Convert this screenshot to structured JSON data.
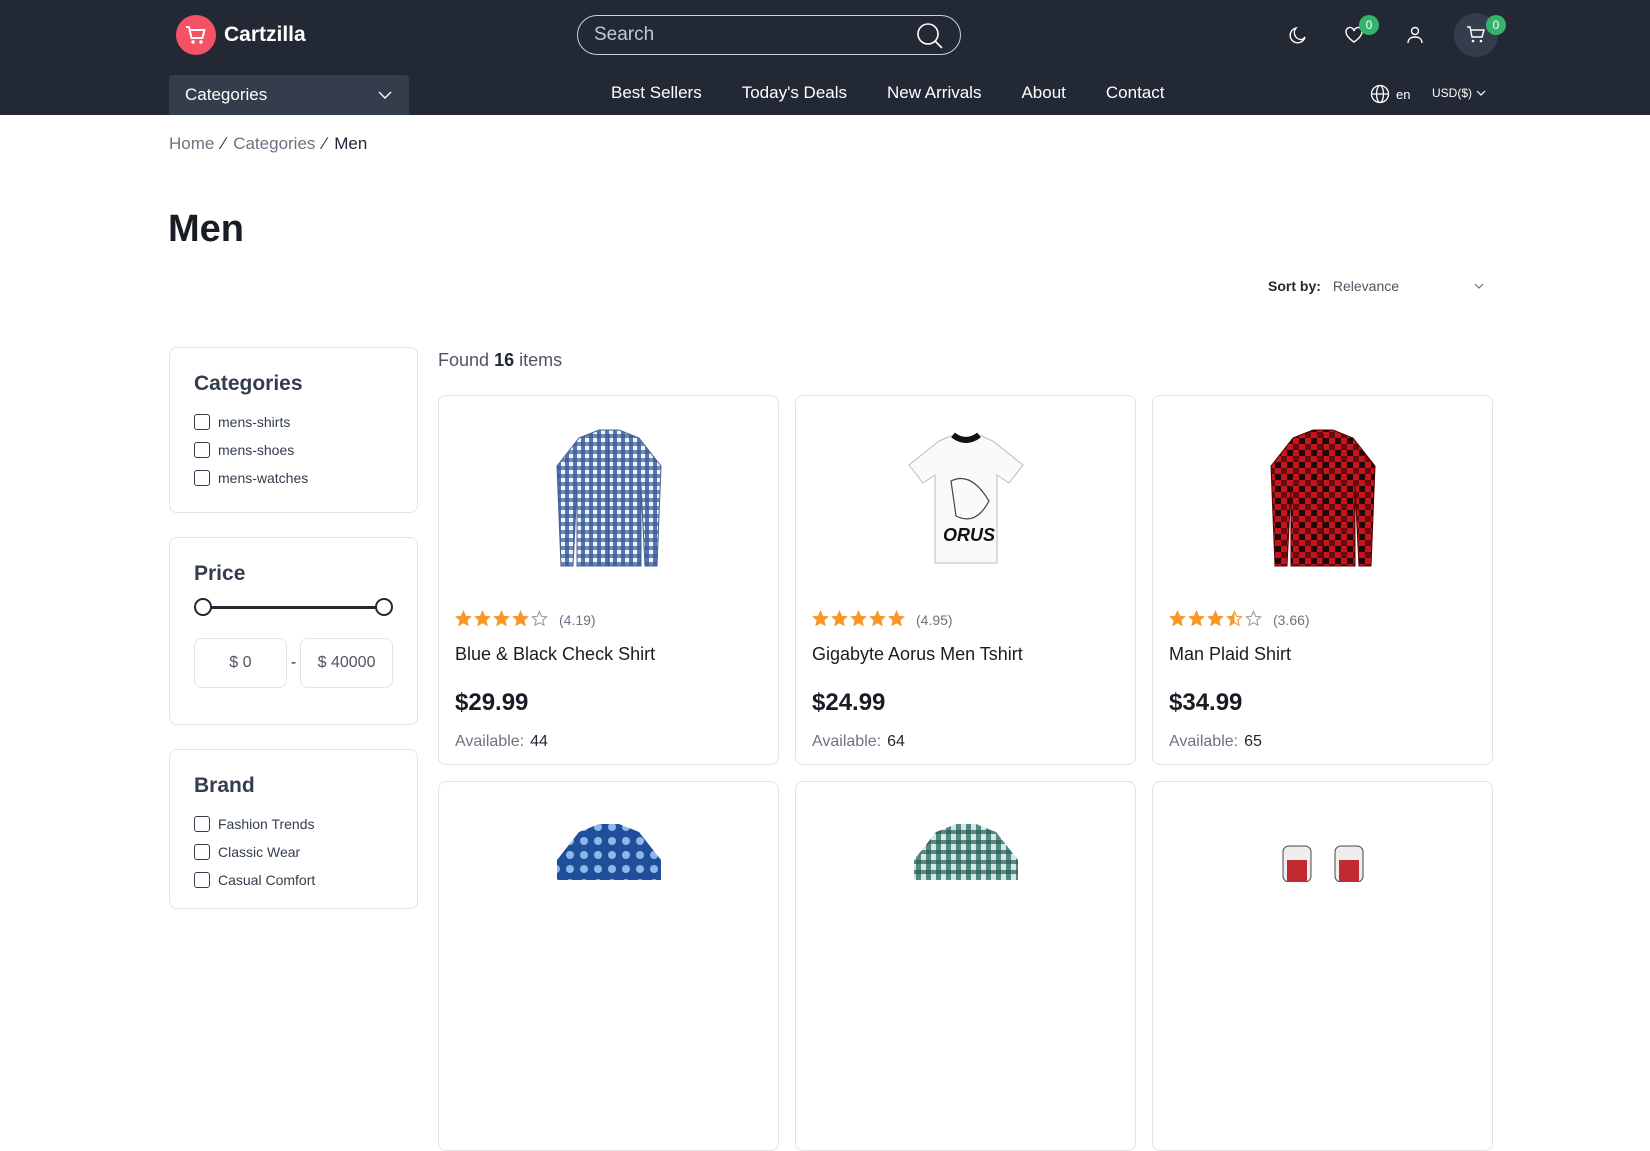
{
  "brand": {
    "name": "Cartzilla",
    "color": "#f55266"
  },
  "search": {
    "placeholder": "Search"
  },
  "header": {
    "wishlist_count": "0",
    "cart_count": "0"
  },
  "categories_dropdown": {
    "label": "Categories"
  },
  "nav": [
    "Best Sellers",
    "Today's Deals",
    "New Arrivals",
    "About",
    "Contact"
  ],
  "language": "en",
  "currency": "USD($)",
  "breadcrumb": {
    "home": "Home",
    "categories": "Categories",
    "current": "Men"
  },
  "page_title": "Men",
  "sort": {
    "label": "Sort by:",
    "value": "Relevance"
  },
  "found": {
    "prefix": "Found",
    "count": "16",
    "suffix": "items"
  },
  "filters": {
    "categories": {
      "title": "Categories",
      "items": [
        "mens-shirts",
        "mens-shoes",
        "mens-watches"
      ]
    },
    "price": {
      "title": "Price",
      "min": "$ 0",
      "max": "$ 40000",
      "separator": "-"
    },
    "brand": {
      "title": "Brand",
      "items": [
        "Fashion Trends",
        "Classic Wear",
        "Casual Comfort"
      ]
    }
  },
  "products": [
    {
      "name": "Blue & Black Check Shirt",
      "rating": 4.19,
      "rating_text": "(4.19)",
      "price": "$29.99",
      "available_label": "Available:",
      "available": "44",
      "image": "blue-check-shirt"
    },
    {
      "name": "Gigabyte Aorus Men Tshirt",
      "rating": 4.95,
      "rating_text": "(4.95)",
      "price": "$24.99",
      "available_label": "Available:",
      "available": "64",
      "image": "aorus-tshirt"
    },
    {
      "name": "Man Plaid Shirt",
      "rating": 3.66,
      "rating_text": "(3.66)",
      "price": "$34.99",
      "available_label": "Available:",
      "available": "65",
      "image": "red-plaid-shirt"
    }
  ],
  "colors": {
    "header_bg": "#222934",
    "star": "#f89828",
    "badge": "#33b36b"
  }
}
